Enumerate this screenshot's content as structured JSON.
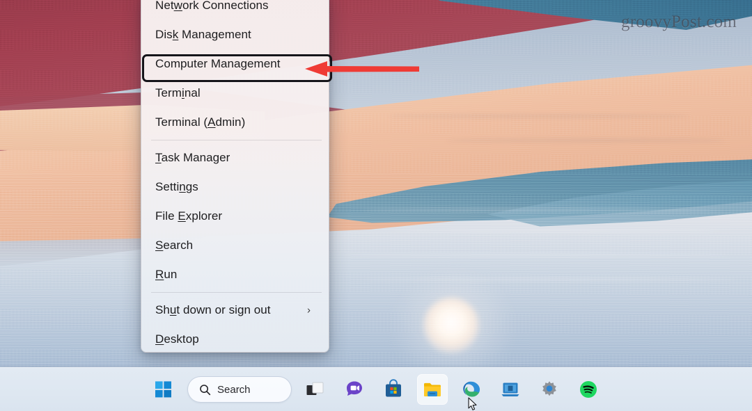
{
  "wallpaper": {
    "description": "windows-11-abstract-landscape-wallpaper",
    "colors": {
      "maroon": "#9d3c4c",
      "peach": "#f0c3a6",
      "blue_top": "#3d7291",
      "blue_mid": "#5c8fab",
      "water": "#a9bdd4",
      "mist": "#c4aeac"
    }
  },
  "watermark": {
    "text": "groovyPost.com"
  },
  "annotation": {
    "highlight_target": "Computer Management",
    "arrow_color": "#ef3b35",
    "box_color": "#15151a"
  },
  "winx_menu": {
    "name": "win-x-power-user-menu",
    "groups": [
      {
        "items": [
          {
            "label": "Network Connections",
            "accel": "w",
            "highlighted": false,
            "submenu": false
          },
          {
            "label": "Disk Management",
            "accel": "k",
            "highlighted": false,
            "submenu": false
          },
          {
            "label": "Computer Management",
            "accel": "",
            "highlighted": true,
            "submenu": false
          },
          {
            "label": "Terminal",
            "accel": "i",
            "highlighted": false,
            "submenu": false
          },
          {
            "label": "Terminal (Admin)",
            "accel": "A",
            "highlighted": false,
            "submenu": false
          }
        ]
      },
      {
        "items": [
          {
            "label": "Task Manager",
            "accel": "T",
            "highlighted": false,
            "submenu": false
          },
          {
            "label": "Settings",
            "accel": "n",
            "highlighted": false,
            "submenu": false
          },
          {
            "label": "File Explorer",
            "accel": "E",
            "highlighted": false,
            "submenu": false
          },
          {
            "label": "Search",
            "accel": "S",
            "highlighted": false,
            "submenu": false
          },
          {
            "label": "Run",
            "accel": "R",
            "highlighted": false,
            "submenu": false
          }
        ]
      },
      {
        "items": [
          {
            "label": "Shut down or sign out",
            "accel": "u",
            "highlighted": false,
            "submenu": true,
            "chevron": "›"
          },
          {
            "label": "Desktop",
            "accel": "D",
            "highlighted": false,
            "submenu": false
          }
        ]
      }
    ]
  },
  "taskbar": {
    "search": {
      "label": "Search",
      "icon": "search-icon"
    },
    "buttons": [
      {
        "name": "start-button",
        "icon": "windows-logo-icon",
        "label": "Start",
        "active": false
      },
      {
        "name": "task-view-button",
        "icon": "task-view-icon",
        "label": "Task View",
        "active": false
      },
      {
        "name": "chat-button",
        "icon": "chat-video-icon",
        "label": "Chat",
        "active": false
      },
      {
        "name": "microsoft-store-button",
        "icon": "store-bag-icon",
        "label": "Microsoft Store",
        "active": false
      },
      {
        "name": "file-explorer-button",
        "icon": "folder-icon",
        "label": "File Explorer",
        "active": true
      },
      {
        "name": "edge-button",
        "icon": "edge-icon",
        "label": "Microsoft Edge",
        "active": false
      },
      {
        "name": "remote-desktop-button",
        "icon": "remote-desktop-icon",
        "label": "Remote Desktop",
        "active": false
      },
      {
        "name": "settings-button",
        "icon": "gear-icon",
        "label": "Settings",
        "active": false
      },
      {
        "name": "spotify-button",
        "icon": "spotify-icon",
        "label": "Spotify",
        "active": false
      }
    ]
  }
}
